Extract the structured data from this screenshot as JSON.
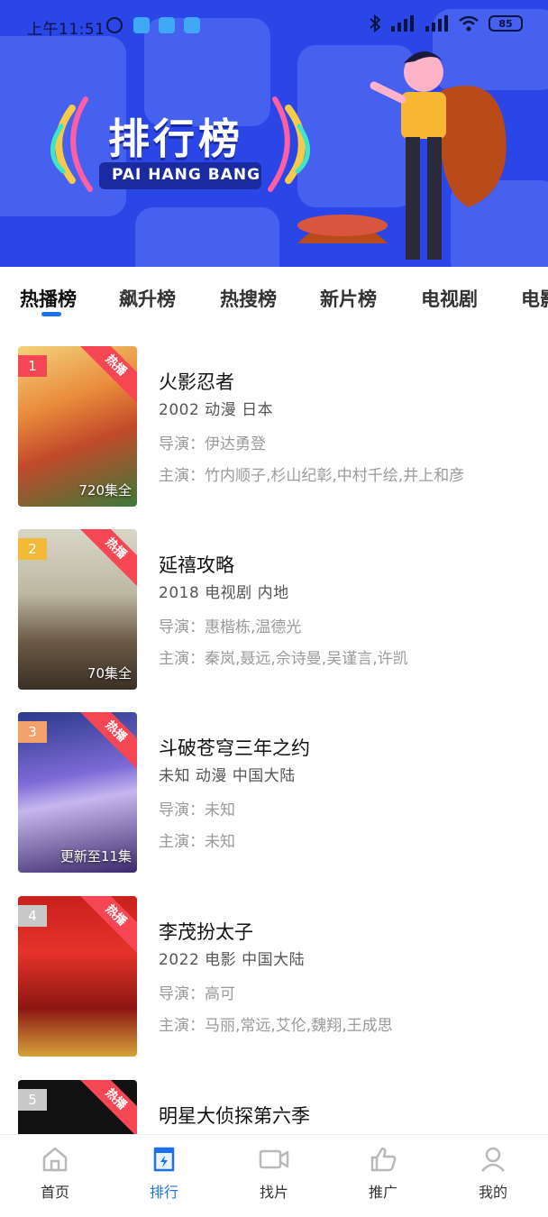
{
  "status_bar": {
    "time": "上午11:51",
    "battery": "85"
  },
  "banner": {
    "title": "排行榜",
    "subtitle": "PAI HANG BANG"
  },
  "tabs": [
    {
      "label": "热播榜",
      "active": true
    },
    {
      "label": "飙升榜",
      "active": false
    },
    {
      "label": "热搜榜",
      "active": false
    },
    {
      "label": "新片榜",
      "active": false
    },
    {
      "label": "电视剧",
      "active": false
    },
    {
      "label": "电影",
      "active": false
    }
  ],
  "ribbon_label": "热播",
  "items": [
    {
      "rank": "1",
      "rank_color": "#f44653",
      "title": "火影忍者",
      "meta": "2002  动漫  日本",
      "director": "导演：伊达勇登",
      "cast": "主演：竹内顺子,杉山纪彰,中村千绘,井上和彦",
      "badge": "720集全"
    },
    {
      "rank": "2",
      "rank_color": "#f5b93a",
      "title": "延禧攻略",
      "meta": "2018  电视剧  内地",
      "director": "导演：惠楷栋,温德光",
      "cast": "主演：秦岚,聂远,佘诗曼,吴谨言,许凯",
      "badge": "70集全"
    },
    {
      "rank": "3",
      "rank_color": "#f3a26b",
      "title": "斗破苍穹三年之约",
      "meta": "未知  动漫  中国大陆",
      "director": "导演：未知",
      "cast": "主演：未知",
      "badge": "更新至11集"
    },
    {
      "rank": "4",
      "rank_color": "#c8c8c8",
      "title": "李茂扮太子",
      "meta": "2022  电影  中国大陆",
      "director": "导演：高可",
      "cast": "主演：马丽,常远,艾伦,魏翔,王成思",
      "badge": ""
    },
    {
      "rank": "5",
      "rank_color": "#c8c8c8",
      "title": "明星大侦探第六季",
      "meta": "",
      "director": "",
      "cast": "",
      "badge": ""
    }
  ],
  "bottom_nav": [
    {
      "label": "首页",
      "icon": "home-icon",
      "active": false
    },
    {
      "label": "排行",
      "icon": "ranking-icon",
      "active": true
    },
    {
      "label": "找片",
      "icon": "video-camera-icon",
      "active": false
    },
    {
      "label": "推广",
      "icon": "thumbs-up-icon",
      "active": false
    },
    {
      "label": "我的",
      "icon": "user-icon",
      "active": false
    }
  ],
  "colors": {
    "accent": "#1d6ff2",
    "banner": "#2b46e6",
    "ribbon": "#f44653"
  }
}
